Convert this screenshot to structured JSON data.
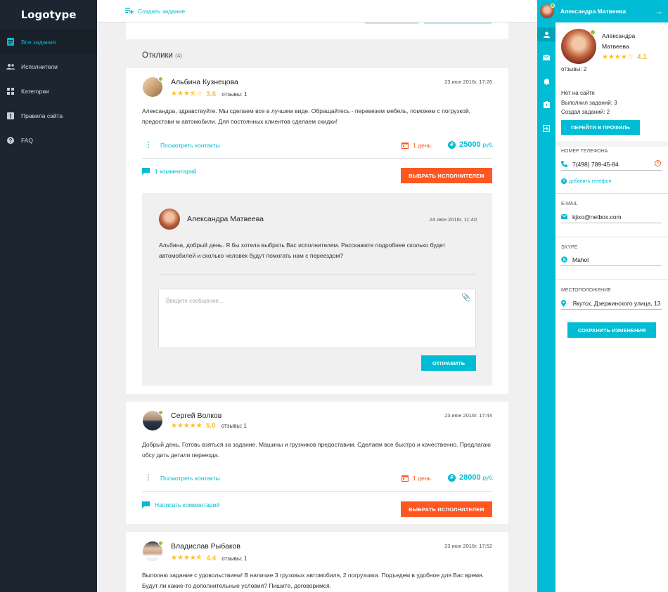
{
  "sidebar": {
    "logo": "Logotype",
    "items": [
      {
        "label": "Все задания",
        "icon": "task-icon",
        "active": true
      },
      {
        "label": "Исполнители",
        "icon": "people-icon"
      },
      {
        "label": "Категории",
        "icon": "grid-icon"
      },
      {
        "label": "Правила сайта",
        "icon": "rules-icon"
      },
      {
        "label": "FAQ",
        "icon": "help-icon"
      }
    ]
  },
  "topbar": {
    "create_label": "Создать задание"
  },
  "responses": {
    "title": "Отклики",
    "count": "(4)",
    "items": [
      {
        "name": "Альбина Кузнецова",
        "rating": "3.6",
        "stars": "★★★⯪☆",
        "reviews": "отзывы: 1",
        "date": "23 июн 2016г. 17:26",
        "text": "Александра, здравствуйте. Мы сделаем все в лучшем виде. Обращайтесь - перевезем мебель, поможем с погрузкой, предостави м автомобили. Для постоянных клиентов сделаем скидки!",
        "contacts_label": "Посмотреть контакты",
        "days": "1 день",
        "price": "25000",
        "currency": "руб.",
        "comment_label": "1 комментарий",
        "choose_label": "ВЫБРАТЬ ИСПОЛНИТЕЛЕМ"
      },
      {
        "name": "Сергей Волков",
        "rating": "5.0",
        "stars": "★★★★★",
        "reviews": "отзывы: 1",
        "date": "23 июн 2016г. 17:44",
        "text": "Добрый день. Готовь взяться за задание. Машины и грузчиков предоставим. Сделаем все быстро и качественно. Предлагаю обсу дить детали переезда.",
        "contacts_label": "Посмотреть контакты",
        "days": "1 день",
        "price": "28000",
        "currency": "руб.",
        "comment_label": "Написать комментарий",
        "choose_label": "ВЫБРАТЬ ИСПОЛНИТЕЛЕМ"
      },
      {
        "name": "Владислав Рыбаков",
        "rating": "4.4",
        "stars": "★★★★⯪",
        "reviews": "отзывы: 1",
        "date": "23 июн 2016г. 17:52",
        "text": "Выполню задание с удовольствием! В наличие 3 грузовых автомобиля, 2 погрузчика. Подъедем в удобное для Вас время. Будут ли какие-то дополнительные условия? Пишите, договоримся."
      }
    ]
  },
  "reply": {
    "name": "Александра Матвеева",
    "date": "24 июн 2016г. 11:40",
    "text": "Альбина, добрый день. Я бы хотела выбрать Вас исполнителем. Расскажите подробнее сколько будет автомобилей и сколько человек будут помогать нам с переездом?",
    "placeholder": "Введите сообщение...",
    "send_label": "ОТПРАВИТЬ"
  },
  "panel": {
    "header_name": "Александра Матвеева",
    "name_line1": "Александра",
    "name_line2": "Матвеева",
    "stars": "★★★★☆",
    "rating": "4.1",
    "reviews": "отзывы: 2",
    "status": "Нет на сайте",
    "completed": "Выполнил заданий: 3",
    "created": "Создал заданий: 2",
    "profile_button": "ПЕРЕЙТИ В ПРОФИЛЬ",
    "phone_label": "НОМЕР ТЕЛЕФОНА",
    "phone": "7(498) 789-45-84",
    "add_phone": "добавить телефон",
    "email_label": "E-MAIL",
    "email": "kjixo@netbox.com",
    "skype_label": "SKYPE",
    "skype": "Mahol",
    "location_label": "МЕСТОПОЛОЖЕНИЕ",
    "location": "Якутск, Дзержинского улица, 13",
    "save_button": "СОХРАНИТЬ ИЗМЕНЕНИЯ"
  },
  "colors": {
    "accent": "#00bcd4",
    "action": "#ff5722",
    "sidebar_bg": "#1c2530",
    "star": "#fbc02d",
    "online": "#8bc34a"
  }
}
